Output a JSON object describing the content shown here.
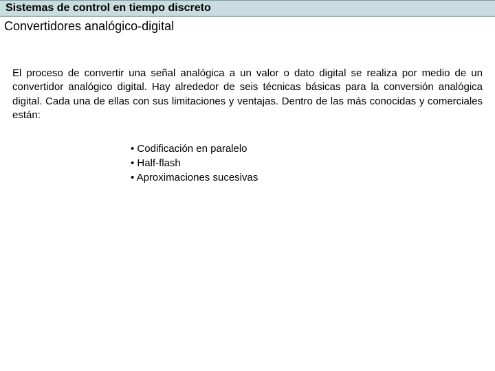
{
  "header": {
    "title": "Sistemas de control en tiempo discreto"
  },
  "subtitle": "Convertidores analógico-digital",
  "paragraph": "El proceso de convertir una señal analógica a un valor o dato digital se realiza por medio de un convertidor analógico digital. Hay alrededor de seis técnicas básicas para la conversión analógica digital. Cada una de ellas con sus limitaciones y ventajas. Dentro de las más conocidas y comerciales están:",
  "bullets": [
    "Codificación en paralelo",
    "Half-flash",
    "Aproximaciones sucesivas"
  ]
}
